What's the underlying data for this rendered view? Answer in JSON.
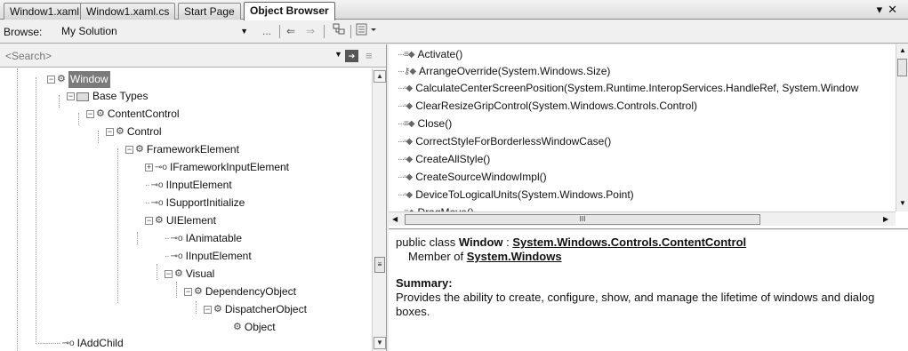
{
  "tabs": [
    {
      "label": "Window1.xaml",
      "active": false
    },
    {
      "label": "Window1.xaml.cs",
      "active": false
    },
    {
      "label": "Start Page",
      "active": false
    },
    {
      "label": "Object Browser",
      "active": true
    }
  ],
  "tab_controls": {
    "dropdown": "▾",
    "close": "✕"
  },
  "toolbar": {
    "browse_label": "Browse:",
    "browse_value": "My Solution",
    "browse_more": "...",
    "back_icon": "⇐",
    "forward_icon": "⇒"
  },
  "search": {
    "placeholder": "<Search>",
    "value": ""
  },
  "tree": {
    "items": [
      {
        "label": "Window",
        "icon": "class-icon",
        "toggle": "−",
        "selected": true
      },
      {
        "label": "Base Types",
        "icon": "folder-icon",
        "toggle": "−"
      },
      {
        "label": "ContentControl",
        "icon": "class-icon",
        "toggle": "−"
      },
      {
        "label": "Control",
        "icon": "class-icon",
        "toggle": "−"
      },
      {
        "label": "FrameworkElement",
        "icon": "class-icon",
        "toggle": "−"
      },
      {
        "label": "IFrameworkInputElement",
        "icon": "interface-icon",
        "toggle": "+"
      },
      {
        "label": "IInputElement",
        "icon": "interface-icon",
        "toggle": ""
      },
      {
        "label": "ISupportInitialize",
        "icon": "interface-icon",
        "toggle": ""
      },
      {
        "label": "UIElement",
        "icon": "class-icon",
        "toggle": "−"
      },
      {
        "label": "IAnimatable",
        "icon": "interface-icon",
        "toggle": ""
      },
      {
        "label": "IInputElement",
        "icon": "interface-icon",
        "toggle": ""
      },
      {
        "label": "Visual",
        "icon": "class-icon",
        "toggle": "−"
      },
      {
        "label": "DependencyObject",
        "icon": "class-icon",
        "toggle": "−"
      },
      {
        "label": "DispatcherObject",
        "icon": "class-icon",
        "toggle": "−"
      },
      {
        "label": "Object",
        "icon": "class-icon",
        "toggle": ""
      },
      {
        "label": "IAddChild",
        "icon": "interface-icon",
        "toggle": ""
      }
    ]
  },
  "members": [
    "Activate()",
    "ArrangeOverride(System.Windows.Size)",
    "CalculateCenterScreenPosition(System.Runtime.InteropServices.HandleRef, System.Window",
    "ClearResizeGripControl(System.Windows.Controls.Control)",
    "Close()",
    "CorrectStyleForBorderlessWindowCase()",
    "CreateAllStyle()",
    "CreateSourceWindowImpl()",
    "DeviceToLogicalUnits(System.Windows.Point)",
    "DragMove()"
  ],
  "scroll_glyphs": {
    "up": "▲",
    "down": "▼",
    "left": "◀",
    "right": "▶",
    "grip": "III",
    "vgrip": "≡"
  },
  "description": {
    "decl_prefix": "public class ",
    "decl_name": "Window",
    "decl_sep": " : ",
    "decl_base": "System.Windows.Controls.ContentControl",
    "member_of_prefix": "Member of ",
    "member_of": "System.Windows",
    "summary_label": "Summary:",
    "summary_text": "Provides the ability to create, configure, show, and manage the lifetime of windows and dialog boxes."
  },
  "colors": {
    "selection": "#7a7a7a",
    "background": "#ffffff",
    "chrome": "#ececec"
  }
}
